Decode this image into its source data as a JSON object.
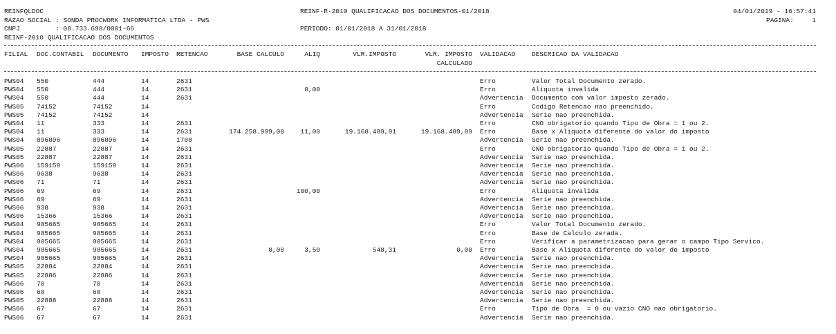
{
  "header": {
    "program": "REINFQLDOC",
    "title": "REINF-R-2010 QUALIFICACAO DOS DOCUMENTOS-01/2018",
    "datetime": "04/01/2019 - 16:57:41",
    "razao": "RAZAO SOCIAL : SONDA PROCWORK INFORMATICA LTDA - PWS",
    "pagina_label": "PAGINA:",
    "pagina_value": "1",
    "cnpj": "CNPJ         : 08.733.698/0001-66",
    "periodo": "PERIODO: 01/01/2018 A 31/01/2018",
    "subtitle": "REINF-2010 QUALIFICACAO DOS DOCUMENTOS"
  },
  "columns": {
    "filial": "FILIAL",
    "doc_contabil": "DOC.CONTABIL",
    "documento": "DOCUMENTO",
    "imposto": "IMPOSTO",
    "retencao": "RETENCAO",
    "base_calculo": "BASE CALCULO",
    "aliq": "ALIQ",
    "vlr_imposto": "VLR.IMPOSTO",
    "vlr_imposto_calc_1": "VLR. IMPOSTO",
    "vlr_imposto_calc_2": "CALCULADO",
    "validacao": "VALIDACAO",
    "descricao": "DESCRICAO DA VALIDACAO"
  },
  "rows": [
    [
      "PWS04",
      "550",
      "444",
      "14",
      "2631",
      "",
      "",
      "",
      "",
      "Erro",
      "Valor Total Documento zerado."
    ],
    [
      "PWS04",
      "550",
      "444",
      "14",
      "2631",
      "",
      "0,00",
      "",
      "",
      "Erro",
      "Aliquota invalida"
    ],
    [
      "PWS04",
      "550",
      "444",
      "14",
      "2631",
      "",
      "",
      "",
      "",
      "Advertencia",
      "Documento com valor imposto zerado."
    ],
    [
      "PWS05",
      "74152",
      "74152",
      "14",
      "",
      "",
      "",
      "",
      "",
      "Erro",
      "Codigo Retencao nao preenchido."
    ],
    [
      "PWS05",
      "74152",
      "74152",
      "14",
      "",
      "",
      "",
      "",
      "",
      "Advertencia",
      "Serie nao preenchida."
    ],
    [
      "PWS04",
      "11",
      "333",
      "14",
      "2631",
      "",
      "",
      "",
      "",
      "Erro",
      "CNO obrigatorio quando Tipo de Obra = 1 ou 2."
    ],
    [
      "PWS04",
      "11",
      "333",
      "14",
      "2631",
      "174.258.999,00",
      "11,00",
      "19.168.489,91",
      "19.168.489,89",
      "Erro",
      "Base x Aliquota diferente do valor do imposto"
    ],
    [
      "PWS04",
      "896896",
      "896896",
      "14",
      "1708",
      "",
      "",
      "",
      "",
      "Advertencia",
      "Serie nao preenchida."
    ],
    [
      "PWS05",
      "22887",
      "22887",
      "14",
      "2631",
      "",
      "",
      "",
      "",
      "Erro",
      "CNO obrigatorio quando Tipo de Obra = 1 ou 2."
    ],
    [
      "PWS05",
      "22887",
      "22887",
      "14",
      "2631",
      "",
      "",
      "",
      "",
      "Advertencia",
      "Serie nao preenchida."
    ],
    [
      "PWS06",
      "159159",
      "159159",
      "14",
      "2631",
      "",
      "",
      "",
      "",
      "Advertencia",
      "Serie nao preenchida."
    ],
    [
      "PWS06",
      "9638",
      "9638",
      "14",
      "2631",
      "",
      "",
      "",
      "",
      "Advertencia",
      "Serie nao preenchida."
    ],
    [
      "PWS06",
      "71",
      "71",
      "14",
      "2631",
      "",
      "",
      "",
      "",
      "Advertencia",
      "Serie nao preenchida."
    ],
    [
      "PWS06",
      "69",
      "69",
      "14",
      "2631",
      "",
      "100,00",
      "",
      "",
      "Erro",
      "Aliquota invalida"
    ],
    [
      "PWS06",
      "69",
      "69",
      "14",
      "2631",
      "",
      "",
      "",
      "",
      "Advertencia",
      "Serie nao preenchida."
    ],
    [
      "PWS06",
      "938",
      "938",
      "14",
      "2631",
      "",
      "",
      "",
      "",
      "Advertencia",
      "Serie nao preenchida."
    ],
    [
      "PWS06",
      "15366",
      "15366",
      "14",
      "2631",
      "",
      "",
      "",
      "",
      "Advertencia",
      "Serie nao preenchida."
    ],
    [
      "PWS04",
      "985665",
      "985665",
      "14",
      "2631",
      "",
      "",
      "",
      "",
      "Erro",
      "Valor Total Documento zerado."
    ],
    [
      "PWS04",
      "985665",
      "985665",
      "14",
      "2631",
      "",
      "",
      "",
      "",
      "Erro",
      "Base de Calculo zerada."
    ],
    [
      "PWS04",
      "985665",
      "985665",
      "14",
      "2631",
      "",
      "",
      "",
      "",
      "Erro",
      "Verificar a parametrizacao para gerar o campo Tipo Servico."
    ],
    [
      "PWS04",
      "985665",
      "985665",
      "14",
      "2631",
      "0,00",
      "3,50",
      "548,31",
      "0,00",
      "Erro",
      "Base x Aliquota diferente do valor do imposto"
    ],
    [
      "PWS04",
      "985665",
      "985665",
      "14",
      "2631",
      "",
      "",
      "",
      "",
      "Advertencia",
      "Serie nao preenchida."
    ],
    [
      "PWS05",
      "22884",
      "22884",
      "14",
      "2631",
      "",
      "",
      "",
      "",
      "Advertencia",
      "Serie nao preenchida."
    ],
    [
      "PWS05",
      "22886",
      "22886",
      "14",
      "2631",
      "",
      "",
      "",
      "",
      "Advertencia",
      "Serie nao preenchida."
    ],
    [
      "PWS06",
      "70",
      "70",
      "14",
      "2631",
      "",
      "",
      "",
      "",
      "Advertencia",
      "Serie nao preenchida."
    ],
    [
      "PWS06",
      "68",
      "68",
      "14",
      "2631",
      "",
      "",
      "",
      "",
      "Advertencia",
      "Serie nao preenchida."
    ],
    [
      "PWS05",
      "22888",
      "22888",
      "14",
      "2631",
      "",
      "",
      "",
      "",
      "Advertencia",
      "Serie nao preenchida."
    ],
    [
      "PWS06",
      "67",
      "67",
      "14",
      "2631",
      "",
      "",
      "",
      "",
      "Erro",
      "Tipo de Obra  = 0 ou vazio CNO nao obrigatorio."
    ],
    [
      "PWS06",
      "67",
      "67",
      "14",
      "2631",
      "",
      "",
      "",
      "",
      "Advertencia",
      "Serie nao preenchida."
    ]
  ]
}
